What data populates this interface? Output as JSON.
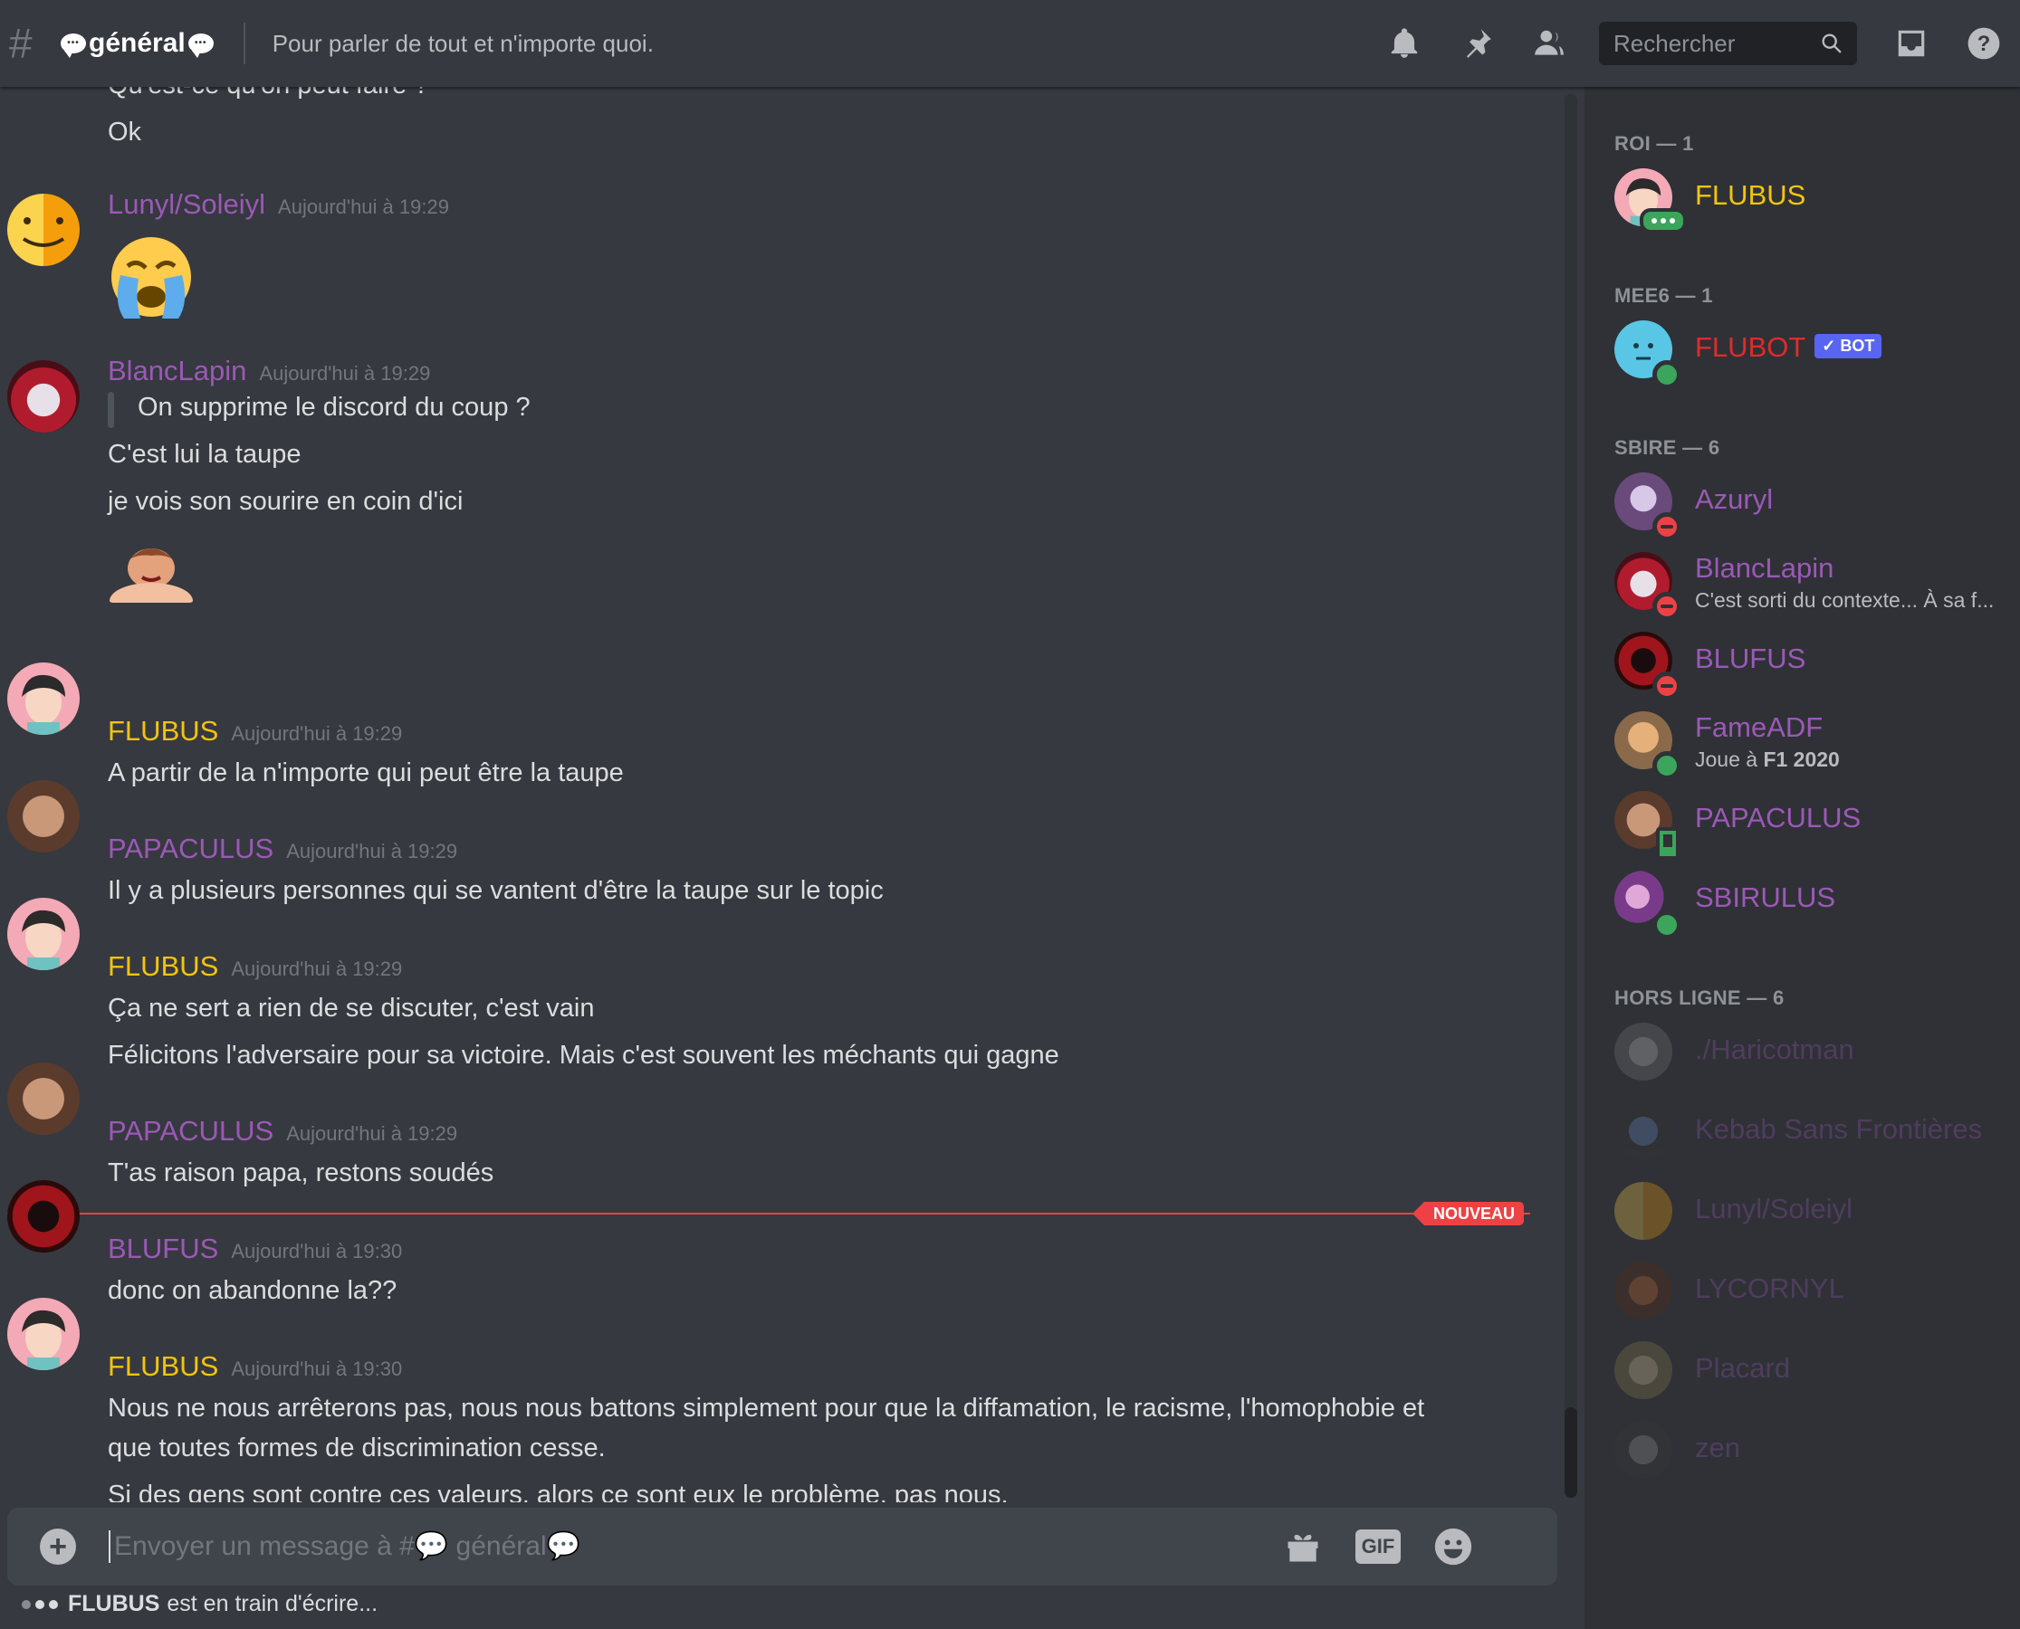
{
  "header": {
    "channel_name": "général",
    "topic": "Pour parler de tout et n'importe quoi.",
    "search_placeholder": "Rechercher"
  },
  "messages": {
    "m0": {
      "line1": "Qu'est-ce qu'on peut faire ?",
      "line2": "Ok"
    },
    "m1": {
      "author": "Lunyl/Soleiyl",
      "time": "Aujourd'hui à 19:29"
    },
    "m2": {
      "author": "BlancLapin",
      "time": "Aujourd'hui à 19:29",
      "quote": "On supprime le discord du coup ?",
      "line1": "C'est lui la taupe",
      "line2": "je vois son sourire en coin d'ici"
    },
    "m3": {
      "author": "FLUBUS",
      "time": "Aujourd'hui à 19:29",
      "line1": "A partir de la n'importe qui peut être la taupe"
    },
    "m4": {
      "author": "PAPACULUS",
      "time": "Aujourd'hui à 19:29",
      "line1": "Il y a plusieurs personnes qui se vantent d'être la taupe sur le topic"
    },
    "m5": {
      "author": "FLUBUS",
      "time": "Aujourd'hui à 19:29",
      "line1": "Ça ne sert a rien de se discuter, c'est vain",
      "line2": "Félicitons l'adversaire pour sa victoire. Mais c'est souvent les méchants qui gagne"
    },
    "m6": {
      "author": "PAPACULUS",
      "time": "Aujourd'hui à 19:29",
      "line1": "T'as raison papa, restons soudés"
    },
    "m7": {
      "author": "BLUFUS",
      "time": "Aujourd'hui à 19:30",
      "line1": "donc on abandonne la??"
    },
    "m8": {
      "author": "FLUBUS",
      "time": "Aujourd'hui à 19:30",
      "line1": "Nous ne nous arrêterons pas, nous nous battons simplement pour que la diffamation, le racisme, l'homophobie et",
      "line2": "que toutes formes de discrimination cesse.",
      "line3": "Si des gens sont contre ces valeurs, alors ce sont eux le problème, pas nous."
    }
  },
  "new_divider_label": "NOUVEAU",
  "composer": {
    "placeholder": "Envoyer un message à #💬 général💬",
    "gif_label": "GIF"
  },
  "typing": {
    "user": "FLUBUS",
    "text": "est en train d'écrire..."
  },
  "members": {
    "groups": {
      "roi": "ROI — 1",
      "mee6": "MEE6 — 1",
      "sbire": "SBIRE — 6",
      "hors_ligne": "HORS LIGNE — 6"
    },
    "flubus": "FLUBUS",
    "flubot": "FLUBOT",
    "bot_tag": "✓ BOT",
    "azuryl": "Azuryl",
    "blanclapin": {
      "name": "BlancLapin",
      "status": "C'est sorti du contexte... À sa f..."
    },
    "blufus": "BLUFUS",
    "fameadf": {
      "name": "FameADF",
      "status_prefix": "Joue à",
      "status_game": "F1 2020"
    },
    "papaculus": "PAPACULUS",
    "sbirulus": "SBIRULUS",
    "offline": [
      "./Haricotman",
      "Kebab Sans Frontières",
      "Lunyl/Soleiyl",
      "LYCORNYL",
      "Placard",
      "zen"
    ]
  },
  "colors": {
    "accent_purple": "#9b59b6",
    "accent_yellow": "#f1c40f",
    "bot_red": "#e02b2b",
    "blurple": "#5865f2",
    "new_red": "#ed4245"
  }
}
